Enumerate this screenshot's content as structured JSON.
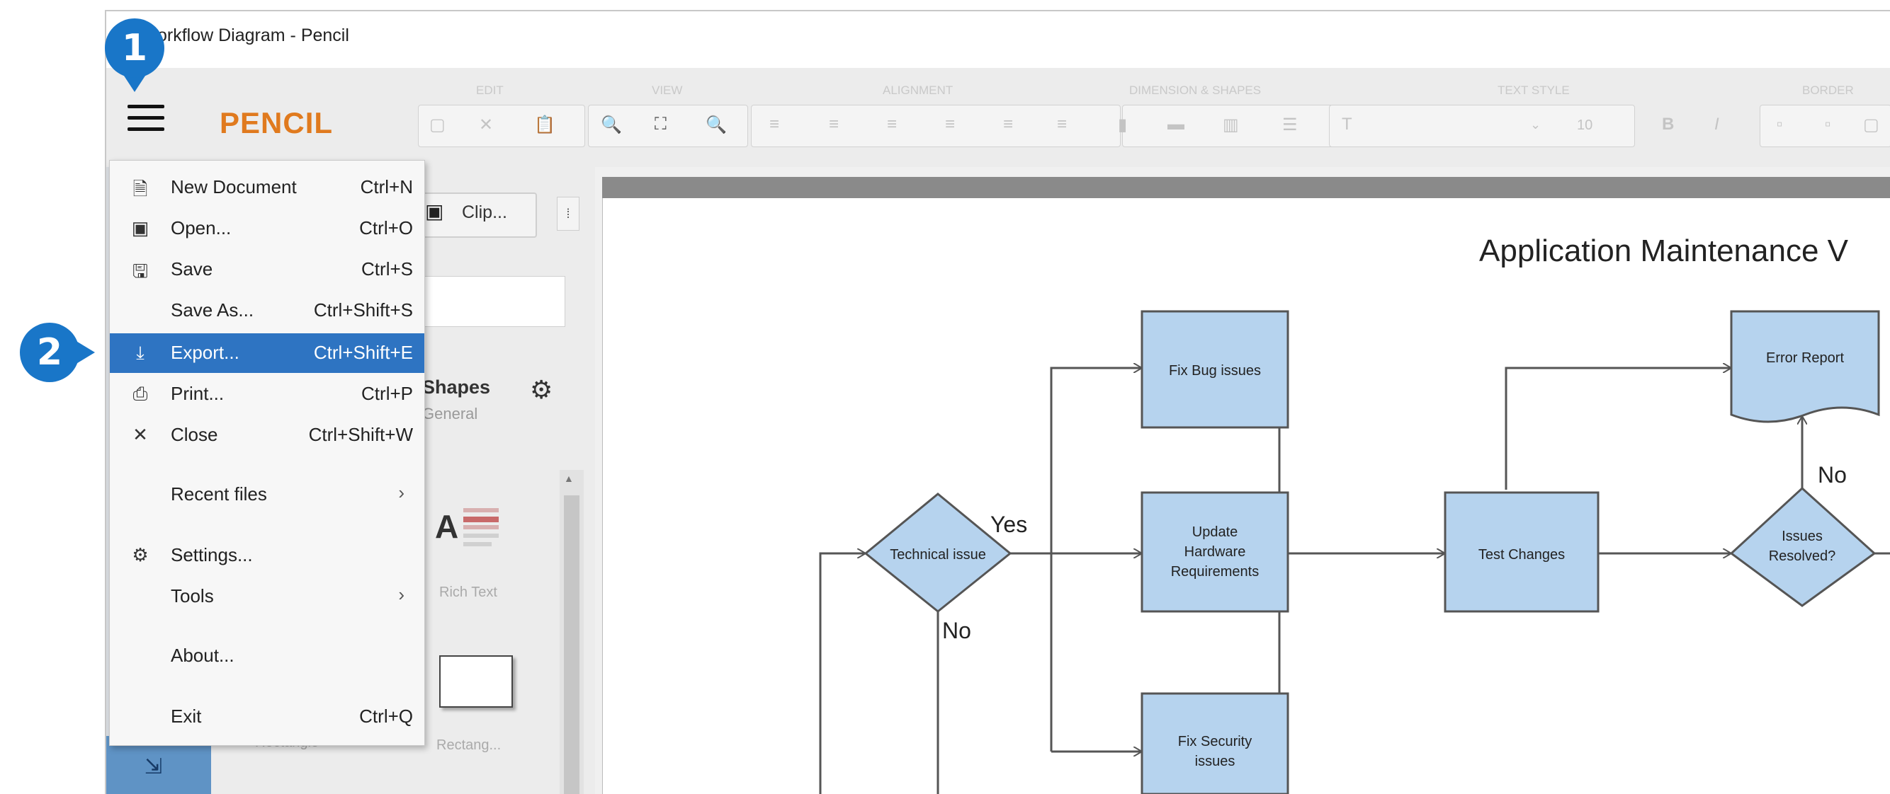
{
  "window": {
    "title": "orkflow Diagram - Pencil"
  },
  "app": {
    "logo": "PENCIL"
  },
  "toolbar": {
    "groups": [
      "EDIT",
      "VIEW",
      "ALIGNMENT",
      "DIMENSION & SHAPES",
      "TEXT STYLE",
      "BORDER"
    ],
    "font_size": "10"
  },
  "sidebar": {
    "clip_tab_label": "Clip...",
    "collection_title": "Shapes",
    "collection_subtitle": "General",
    "shape_labels": [
      "Rich Text",
      "Rectangle",
      "Rectang..."
    ]
  },
  "menu": {
    "items": [
      {
        "label": "New Document",
        "shortcut": "Ctrl+N",
        "icon": "new-document-icon"
      },
      {
        "label": "Open...",
        "shortcut": "Ctrl+O",
        "icon": "open-icon"
      },
      {
        "label": "Save",
        "shortcut": "Ctrl+S",
        "icon": "save-icon"
      },
      {
        "label": "Save As...",
        "shortcut": "Ctrl+Shift+S",
        "icon": ""
      },
      {
        "label": "Export...",
        "shortcut": "Ctrl+Shift+E",
        "icon": "export-icon",
        "highlighted": true
      },
      {
        "label": "Print...",
        "shortcut": "Ctrl+P",
        "icon": "print-icon"
      },
      {
        "label": "Close",
        "shortcut": "Ctrl+Shift+W",
        "icon": "close-icon"
      },
      {
        "label": "Recent files",
        "shortcut": "",
        "icon": "",
        "submenu": true
      },
      {
        "label": "Settings...",
        "shortcut": "",
        "icon": "gear-icon"
      },
      {
        "label": "Tools",
        "shortcut": "",
        "icon": "",
        "submenu": true
      },
      {
        "label": "About...",
        "shortcut": "",
        "icon": ""
      },
      {
        "label": "Exit",
        "shortcut": "Ctrl+Q",
        "icon": ""
      }
    ]
  },
  "callouts": {
    "step1": "1",
    "step2": "2"
  },
  "diagram": {
    "title": "Application Maintenance V",
    "nodes": {
      "fix_bug": "Fix Bug issues",
      "update_hw": [
        "Update",
        "Hardware",
        "Requirements"
      ],
      "fix_security": [
        "Fix Security",
        "issues"
      ],
      "technical_issue": "Technical issue",
      "test_changes": "Test Changes",
      "error_report": "Error Report",
      "issues_resolved": [
        "Issues",
        "Resolved?"
      ]
    },
    "edge_labels": {
      "yes": "Yes",
      "no_technical": "No",
      "no_resolved": "No"
    }
  },
  "colors": {
    "accent": "#2e74c2",
    "callout": "#1976c8",
    "logo": "#e07a1e",
    "node_fill": "#b6d3ee",
    "node_stroke": "#555555"
  }
}
